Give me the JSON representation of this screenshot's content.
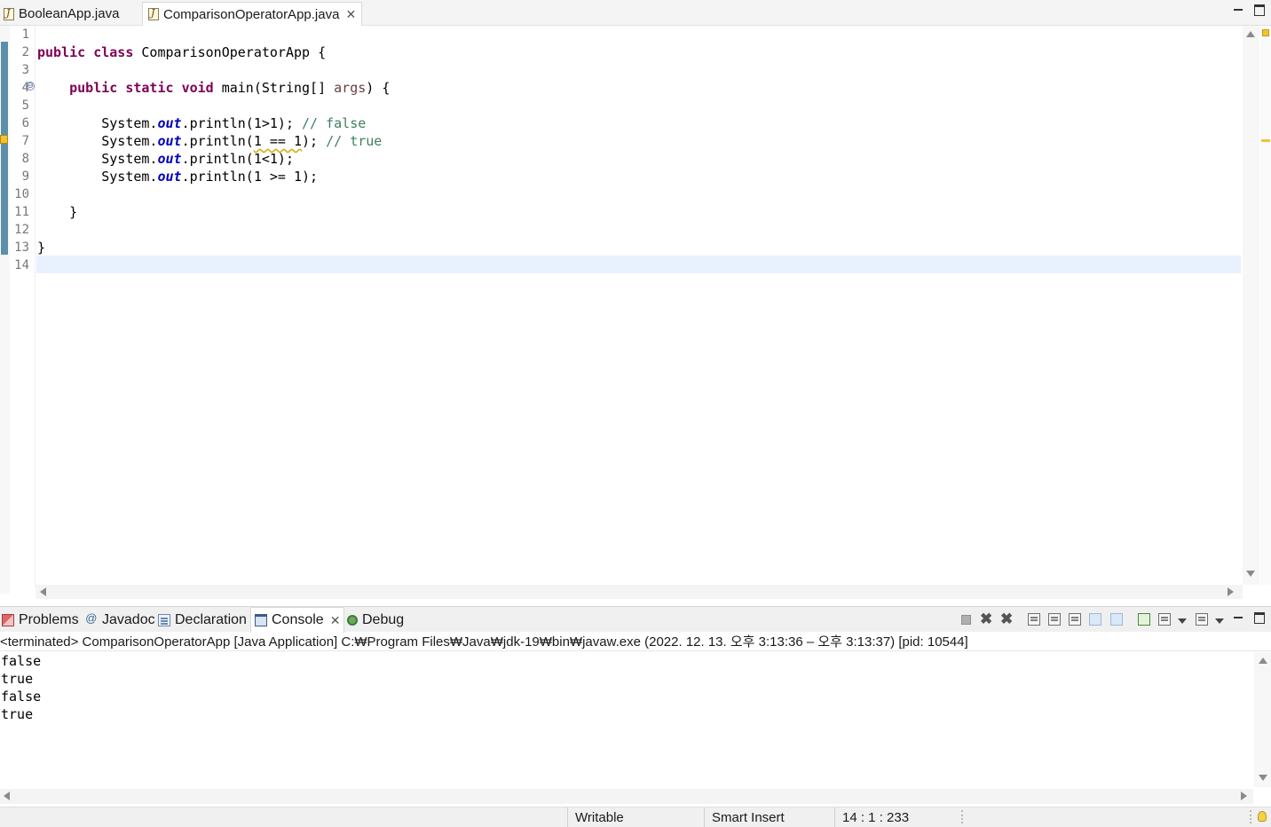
{
  "editor_tabs": [
    {
      "label": "BooleanApp.java",
      "icon": "java-file-icon",
      "active": false
    },
    {
      "label": "ComparisonOperatorApp.java",
      "icon": "java-file-icon",
      "active": true
    }
  ],
  "editor": {
    "line_numbers": [
      "1",
      "2",
      "3",
      "4",
      "5",
      "6",
      "7",
      "8",
      "9",
      "10",
      "11",
      "12",
      "13",
      "14"
    ],
    "code": {
      "l2": {
        "kw_public": "public",
        "kw_class": "class",
        "class_decl": " ComparisonOperatorApp {"
      },
      "l4": {
        "indent": "    ",
        "kw_public": "public",
        "kw_static": "static",
        "kw_void": "void",
        "method_sig": " main(String[] ",
        "param": "args",
        "open_brace": ") {"
      },
      "l6": {
        "prefix": "        System.",
        "field": "out",
        "call": ".println(1>1); ",
        "comment": "// false"
      },
      "l7": {
        "prefix": "        System.",
        "field": "out",
        "call_open": ".println(",
        "warn_expr": "1 == 1",
        "call_close": "); ",
        "comment": "// true"
      },
      "l8": {
        "prefix": "        System.",
        "field": "out",
        "call": ".println(1<1);"
      },
      "l9": {
        "prefix": "        System.",
        "field": "out",
        "call": ".println(1 >= 1);"
      },
      "l11": "    }",
      "l13": "}"
    },
    "current_line": 14,
    "fold_glyph": "⊖"
  },
  "bottom_tabs": [
    {
      "label": "Problems",
      "icon": "problems-icon",
      "active": false
    },
    {
      "label": "Javadoc",
      "icon": "javadoc-icon",
      "active": false
    },
    {
      "label": "Declaration",
      "icon": "declaration-icon",
      "active": false
    },
    {
      "label": "Console",
      "icon": "console-icon",
      "active": true,
      "close": "✕"
    },
    {
      "label": "Debug",
      "icon": "debug-icon",
      "active": false
    }
  ],
  "console": {
    "header": "<terminated> ComparisonOperatorApp [Java Application] C:₩Program Files₩Java₩jdk-19₩bin₩javaw.exe  (2022. 12. 13. 오후 3:13:36 – 오후 3:13:37) [pid: 10544]",
    "output": [
      "false",
      "true",
      "false",
      "true"
    ]
  },
  "status_bar": {
    "writable": "Writable",
    "insert_mode": "Smart Insert",
    "position": "14 : 1 : 233"
  },
  "glyphs": {
    "close": "✕",
    "remove_launch": "✖",
    "remove_all": "✖"
  },
  "colors": {
    "keyword": "#7f0055",
    "field": "#0000c0",
    "comment": "#3f7f5f",
    "parameter": "#6a3e3e",
    "current_line": "#e8f2fe",
    "change_bar": "#5c8fa8"
  }
}
